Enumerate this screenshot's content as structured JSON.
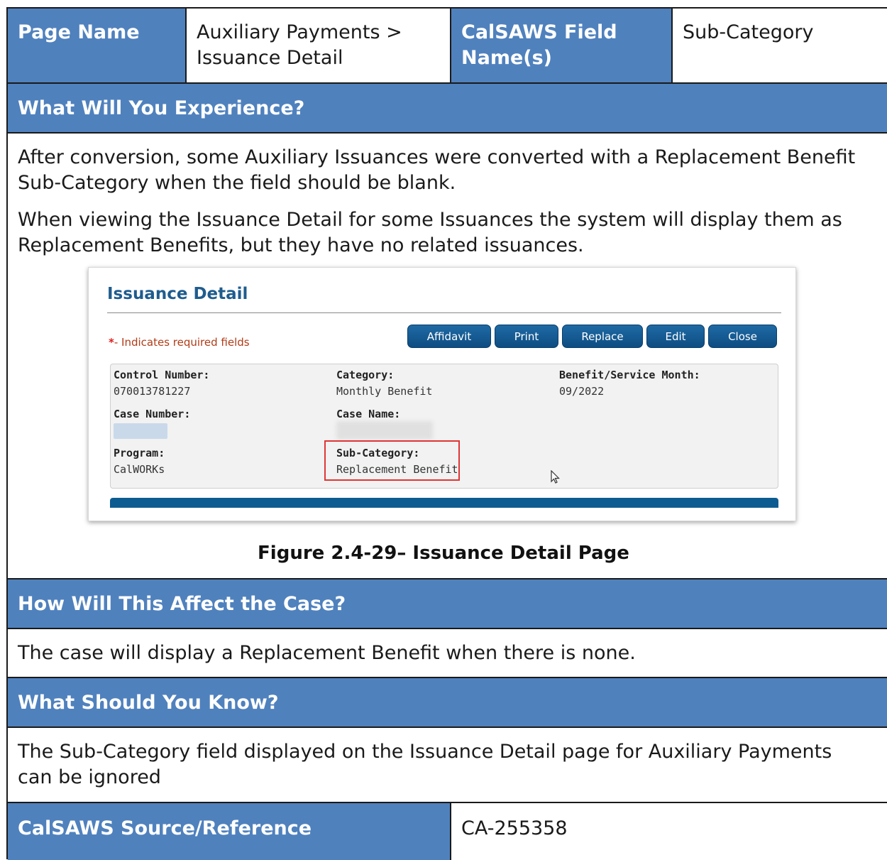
{
  "header": {
    "page_name_label": "Page Name",
    "page_name_value": "Auxiliary Payments > Issuance Detail",
    "field_label": "CalSAWS Field Name(s)",
    "field_value": "Sub-Category"
  },
  "sections": {
    "experience_title": "What Will You Experience?",
    "experience_p1": "After conversion, some Auxiliary Issuances were converted with a Replacement Benefit Sub-Category when the field should be blank.",
    "experience_p2": "When viewing the Issuance Detail for some Issuances the system will display them as Replacement Benefits, but they have no related issuances.",
    "affect_title": "How Will This Affect the Case?",
    "affect_text": "The case will display a Replacement Benefit when there is none.",
    "know_title": "What Should You Know?",
    "know_text": "The Sub-Category field displayed on the Issuance Detail page for Auxiliary Payments can be ignored",
    "source_label": "CalSAWS Source/Reference",
    "source_value": "CA-255358"
  },
  "figure": {
    "caption": "Figure 2.4-29– Issuance Detail Page",
    "screen_title": "Issuance Detail",
    "required_star": "*",
    "required_text": "- Indicates required fields",
    "buttons": [
      "Affidavit",
      "Print",
      "Replace",
      "Edit",
      "Close"
    ],
    "fields": {
      "control_number_label": "Control Number:",
      "control_number_value": "070013781227",
      "category_label": "Category:",
      "category_value": "Monthly Benefit",
      "month_label": "Benefit/Service Month:",
      "month_value": "09/2022",
      "case_number_label": "Case Number:",
      "case_name_label": "Case Name:",
      "program_label": "Program:",
      "program_value": "CalWORKs",
      "subcategory_label": "Sub-Category:",
      "subcategory_value": "Replacement Benefit"
    }
  }
}
